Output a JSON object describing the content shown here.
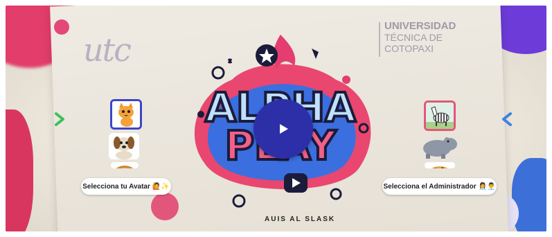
{
  "header": {
    "logo_text": "utc",
    "university": {
      "line1": "UNIVERSIDAD",
      "line2": "TÉCNICA DE",
      "line3": "COTOPAXI"
    }
  },
  "main": {
    "game_logo": {
      "line1": "ALPHA",
      "line2": "PLAY"
    },
    "tagline": "AUIS AL SLASK",
    "play_button_icon": "play-icon"
  },
  "avatar_picker": {
    "label": "Selecciona tu Avatar",
    "emoji": "🙋✨",
    "prev_icon": "chevron-right-icon",
    "items": [
      {
        "name": "cat",
        "selected": true
      },
      {
        "name": "dog",
        "selected": false
      },
      {
        "name": "lion",
        "selected": false
      }
    ]
  },
  "admin_picker": {
    "label": "Selecciona el Administrador",
    "emoji": "👩‍💼👨‍💼",
    "next_icon": "chevron-left-icon",
    "items": [
      {
        "name": "zebra",
        "selected": true
      },
      {
        "name": "hippo",
        "selected": false
      },
      {
        "name": "giraffe",
        "selected": false
      }
    ]
  },
  "colors": {
    "play_button": "#2d2fa9",
    "left_arrow": "#3cc05a",
    "right_arrow": "#3d82e0",
    "avatar_selected_border": "#3b46c6",
    "admin_selected_border": "#e2577a"
  }
}
